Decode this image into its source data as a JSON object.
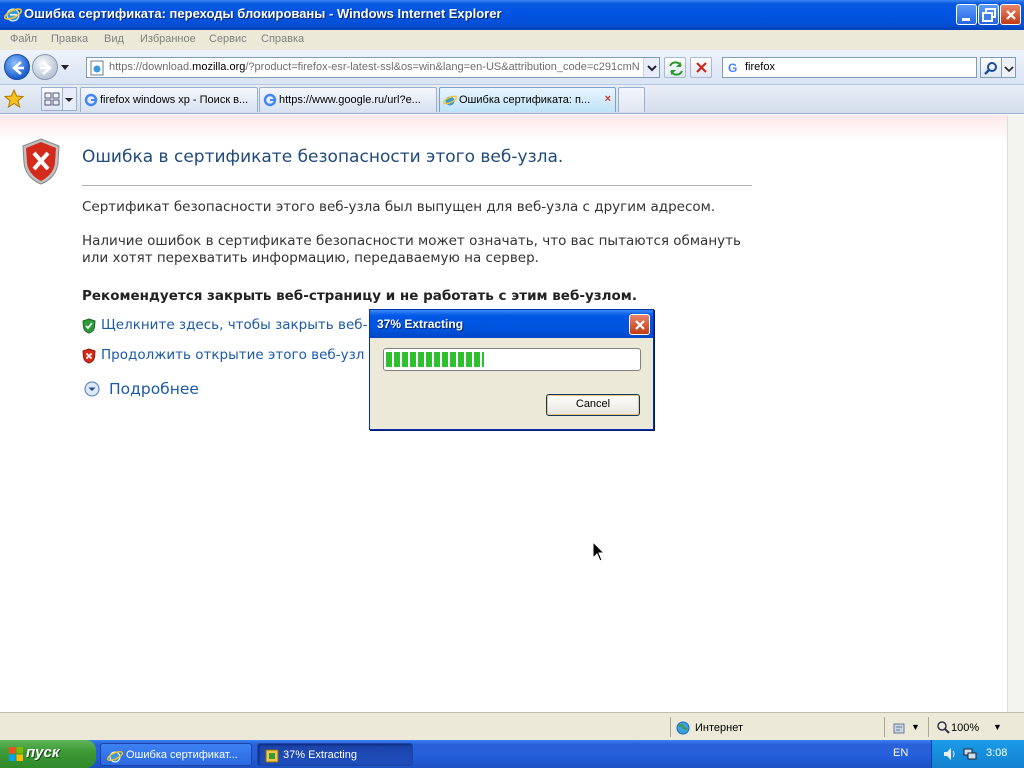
{
  "window": {
    "title": "Ошибка сертификата: переходы блокированы - Windows Internet Explorer"
  },
  "menu": [
    "Файл",
    "Правка",
    "Вид",
    "Избранное",
    "Сервис",
    "Справка"
  ],
  "address_bar": {
    "url_prefix": "https://download.",
    "url_domain": "mozilla.org",
    "url_rest": "/?product=firefox-esr-latest-ssl&os=win&lang=en-US&attribution_code=c291cmN"
  },
  "search": {
    "value": "firefox",
    "engine_glyph": "G"
  },
  "tabs": [
    {
      "label": "firefox windows xp - Поиск в...",
      "icon": "google-icon",
      "active": false
    },
    {
      "label": "https://www.google.ru/url?e...",
      "icon": "google-icon",
      "active": false
    },
    {
      "label": "Ошибка сертификата: п...",
      "icon": "ie-page-icon",
      "active": true,
      "close": "×"
    }
  ],
  "page": {
    "title": "Ошибка в сертификате безопасности этого веб-узла.",
    "paragraph1": "Сертификат безопасности этого веб-узла был выпущен для веб-узла с другим адресом.",
    "paragraph2": "Наличие ошибок в сертификате безопасности может означать, что вас пытаются обмануть или хотят перехватить информацию, передаваемую на сервер.",
    "recommendation": "Рекомендуется закрыть веб-страницу и не работать с этим веб-узлом.",
    "action_close": "Щелкните здесь, чтобы закрыть веб-",
    "action_continue": "Продолжить открытие этого веб-узл",
    "more_info": "Подробнее"
  },
  "dialog": {
    "title": "37% Extracting",
    "progress_fraction": 0.39,
    "cancel_label": "Cancel"
  },
  "statusbar": {
    "zone": "Интернет",
    "zoom": "100%",
    "zoom_arrow": "▼"
  },
  "taskbar": {
    "start_label": "пуск",
    "items": [
      {
        "label": "Ошибка сертификат..."
      },
      {
        "label": "37% Extracting"
      }
    ],
    "language": "EN",
    "clock": "3:08"
  },
  "colors": {
    "xp_blue": "#0054e3",
    "link": "#1a5aa6",
    "progress_green": "#2fbf2f"
  }
}
